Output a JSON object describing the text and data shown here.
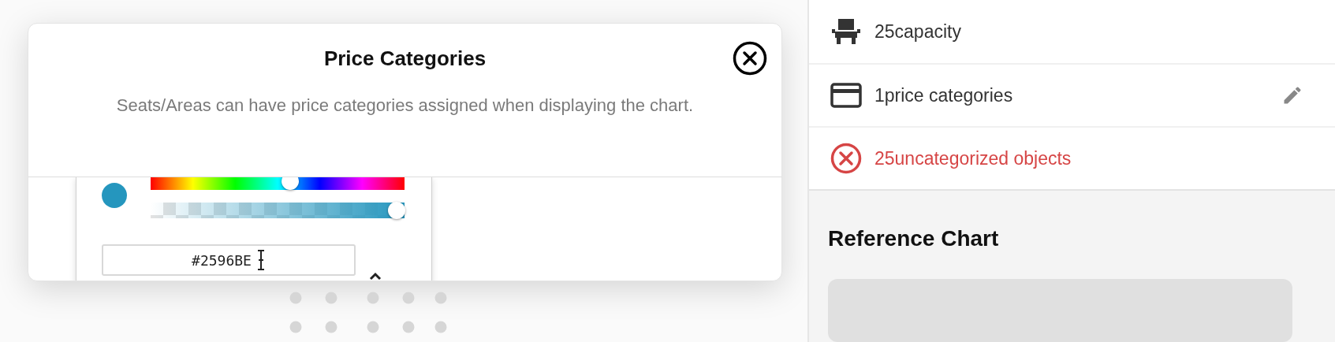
{
  "dialog": {
    "title": "Price Categories",
    "description": "Seats/Areas can have price categories assigned when displaying the chart.",
    "color_picker": {
      "color": "#2596be",
      "hue": {
        "level": 0.55
      },
      "alpha": {
        "level": 1
      },
      "hex": {
        "value": "#2596BE"
      }
    }
  },
  "summary": [
    {
      "kind": "capacity",
      "text": "25capacity",
      "editable": false,
      "error": false
    },
    {
      "kind": "categories",
      "text": "1price categories",
      "editable": true,
      "error": false
    },
    {
      "kind": "uncategorized",
      "text": "25uncategorized objects",
      "editable": false,
      "error": true
    }
  ],
  "reference_chart": {
    "title": "Reference Chart"
  }
}
